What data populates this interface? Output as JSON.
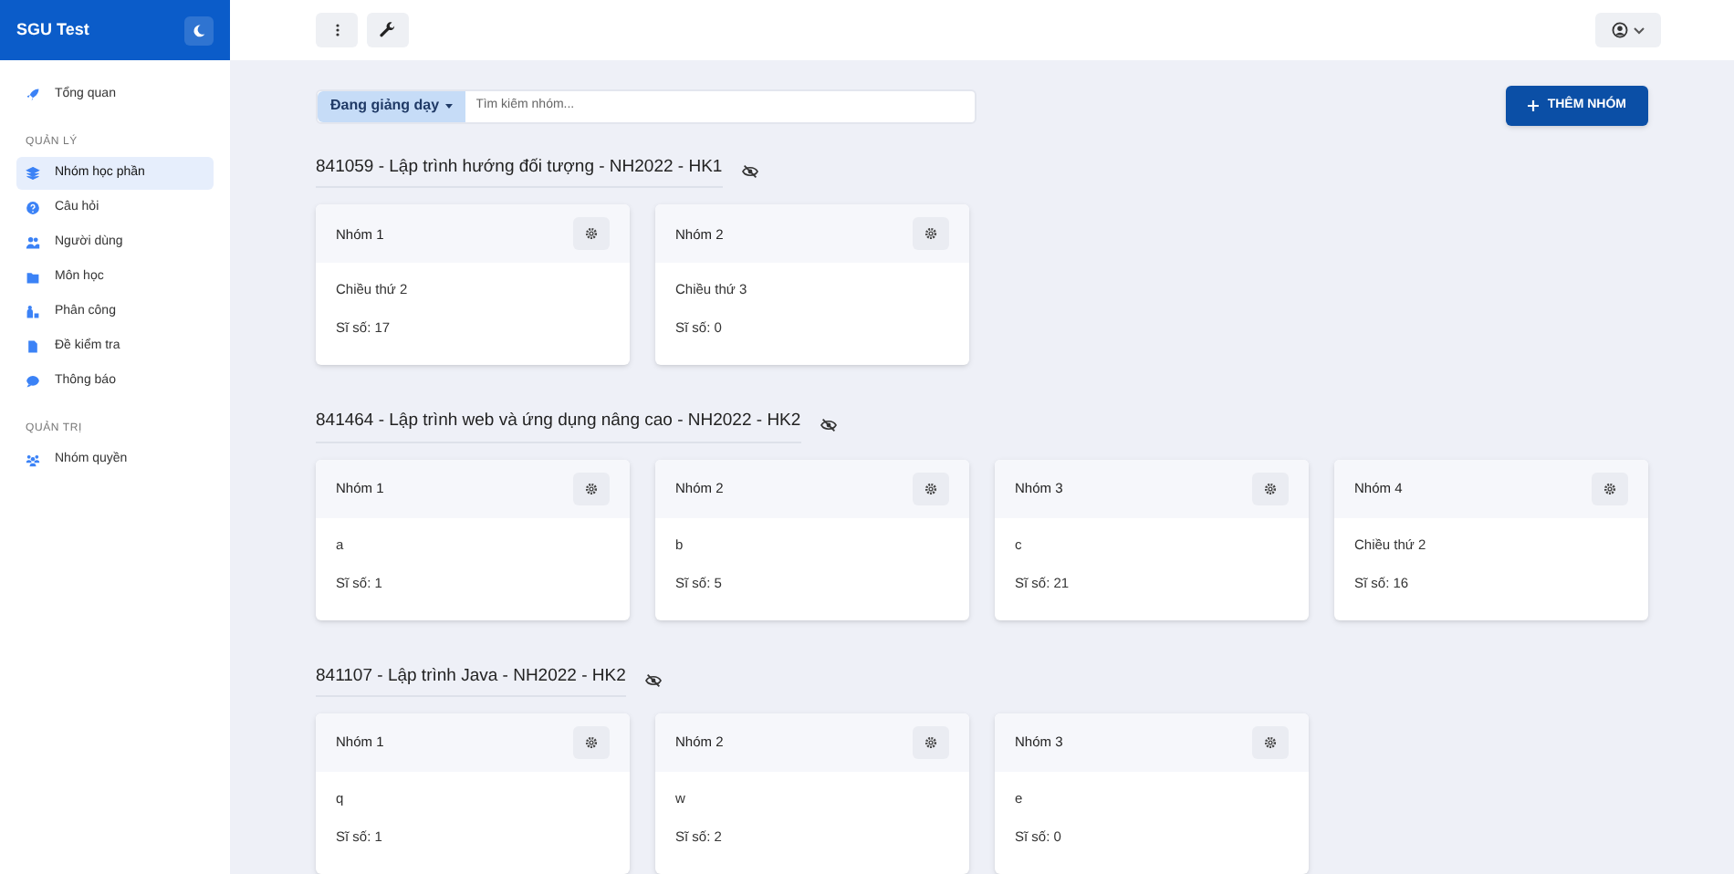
{
  "sidebar": {
    "brand": "SGU Test",
    "sections": [
      {
        "items": [
          {
            "label": "Tổng quan",
            "selected": false
          }
        ]
      },
      {
        "heading": "QUẢN LÝ",
        "items": [
          {
            "label": "Nhóm học phần",
            "selected": true
          },
          {
            "label": "Câu hỏi",
            "selected": false
          },
          {
            "label": "Người dùng",
            "selected": false
          },
          {
            "label": "Môn học",
            "selected": false
          },
          {
            "label": "Phân công",
            "selected": false
          },
          {
            "label": "Đề kiểm tra",
            "selected": false
          },
          {
            "label": "Thông báo",
            "selected": false
          }
        ]
      },
      {
        "heading": "QUẢN TRỊ",
        "items": [
          {
            "label": "Nhóm quyền",
            "selected": false
          }
        ]
      }
    ]
  },
  "toolbar": {
    "filter": "Đang giảng dạy",
    "search": {
      "placeholder": "Tìm kiếm nhóm..."
    },
    "add_button": "THÊM NHÓM"
  },
  "courses": [
    {
      "title": "841059 - Lập trình hướng đối tượng - NH2022 - HK1",
      "groups": [
        {
          "name": "Nhóm 1",
          "note": "Chiều thứ 2",
          "count": "Sĩ số: 17"
        },
        {
          "name": "Nhóm 2",
          "note": "Chiều thứ 3",
          "count": "Sĩ số: 0"
        }
      ]
    },
    {
      "title": "841464 - Lập trình web và ứng dụng nâng cao - NH2022 - HK2",
      "groups": [
        {
          "name": "Nhóm 1",
          "note": "a",
          "count": "Sĩ số: 1"
        },
        {
          "name": "Nhóm 2",
          "note": "b",
          "count": "Sĩ số: 5"
        },
        {
          "name": "Nhóm 3",
          "note": "c",
          "count": "Sĩ số: 21"
        },
        {
          "name": "Nhóm 4",
          "note": "Chiều thứ 2",
          "count": "Sĩ số: 16"
        }
      ]
    },
    {
      "title": "841107 - Lập trình Java - NH2022 - HK2",
      "groups": [
        {
          "name": "Nhóm 1",
          "note": "q",
          "count": "Sĩ số: 1"
        },
        {
          "name": "Nhóm 2",
          "note": "w",
          "count": "Sĩ số: 2"
        },
        {
          "name": "Nhóm 3",
          "note": "e",
          "count": "Sĩ số: 0"
        }
      ]
    }
  ]
}
